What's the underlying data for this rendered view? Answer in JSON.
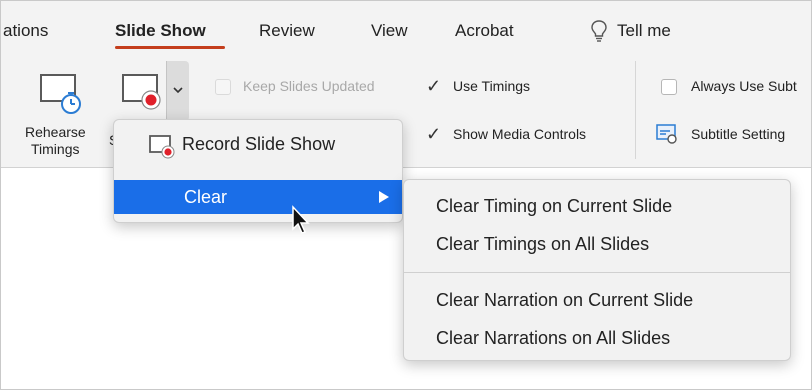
{
  "tabs": [
    "ations",
    "Slide Show",
    "Review",
    "View",
    "Acrobat",
    "Tell me"
  ],
  "ribbon": {
    "rehearse_label_1": "Rehearse",
    "rehearse_label_2": "Timings",
    "rehearse_obscured": "S",
    "keep_slides_updated": "Keep Slides Updated",
    "use_timings": "Use Timings",
    "show_media_controls": "Show Media Controls",
    "always_use_subtitles": "Always Use Subt",
    "subtitle_settings": "Subtitle Setting"
  },
  "menu": {
    "record_slide_show": "Record Slide Show",
    "clear": "Clear"
  },
  "submenu": {
    "items": [
      "Clear Timing on Current Slide",
      "Clear Timings on All Slides",
      "Clear Narration on Current Slide",
      "Clear Narrations on All Slides"
    ]
  },
  "colors": {
    "accent_underline": "#c43e1c",
    "menu_highlight": "#1a6ee8",
    "record_dot": "#e0202a"
  }
}
